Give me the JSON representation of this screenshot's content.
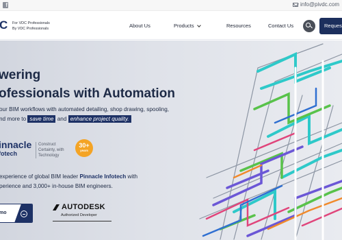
{
  "topbar": {
    "facebook_icon": "facebook-icon",
    "email_icon": "envelope-icon",
    "email": "info@pivdc.com"
  },
  "nav": {
    "logo_letter": "C",
    "tagline_line1": "For VDC Professionals",
    "tagline_line2": "By VDC Professionals",
    "items": [
      {
        "label": "About Us"
      },
      {
        "label": "Products"
      },
      {
        "label": "Resources"
      },
      {
        "label": "Contact Us"
      }
    ],
    "search_icon": "search-icon",
    "request_label": "Request"
  },
  "hero": {
    "headline_line1": "wering",
    "headline_line2": "ofessionals with Automation",
    "para_line1": "our BIM workflows with automated detailing, shop drawing, spooling,",
    "para_line2_start": "nd more to",
    "highlight1": "save time",
    "para_line2_mid": "and",
    "highlight2": "enhance project quality.",
    "pinnacle_name": "innacle",
    "pinnacle_sub": "fotech",
    "pinnacle_tagline_1": "Construct",
    "pinnacle_tagline_2": "Certainty, with",
    "pinnacle_tagline_3": "Technology",
    "badge_number": "30+",
    "badge_label": "years",
    "exp_line1_start": "experience of global BIM leader",
    "exp_line1_link": "Pinnacle Infotech",
    "exp_line1_end": "with",
    "exp_line2": "perience and 3,000+ in-house BIM engineers.",
    "demo_label": "mo",
    "autodesk_word": "AUTODESK",
    "autodesk_sub": "Authorized Developer",
    "accent_color": "#1d3165",
    "badge_color": "#f4a425"
  }
}
